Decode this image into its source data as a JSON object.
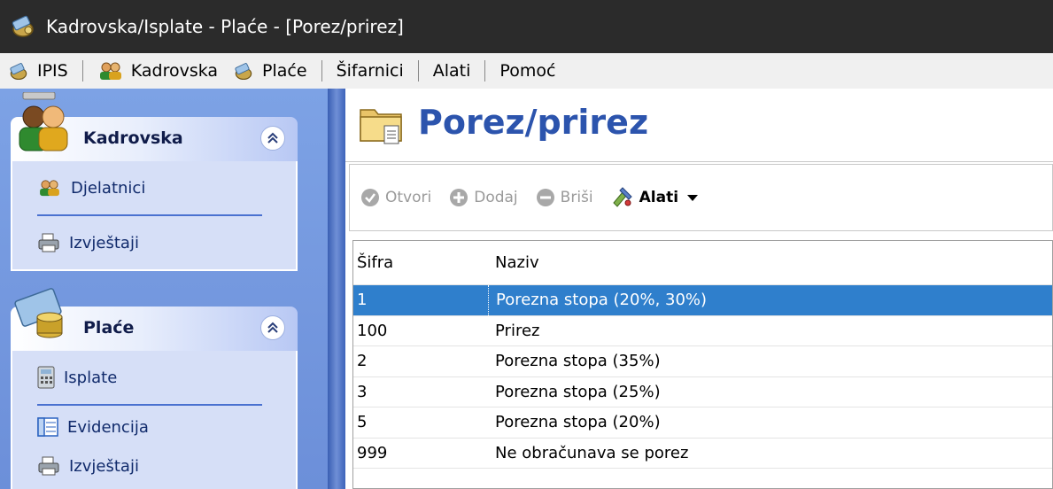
{
  "window": {
    "title": "Kadrovska/Isplate - Plaće - [Porez/prirez]",
    "app_icon": "money-bag-icon"
  },
  "menu": {
    "items": [
      {
        "label": "IPIS",
        "icon": "money-bag-icon"
      },
      {
        "label": "Kadrovska",
        "icon": "users-icon"
      },
      {
        "label": "Plaće",
        "icon": "money-bag-icon"
      },
      {
        "label": "Šifarnici",
        "icon": ""
      },
      {
        "label": "Alati",
        "icon": ""
      },
      {
        "label": "Pomoć",
        "icon": ""
      }
    ]
  },
  "sidebar": {
    "groups": [
      {
        "title": "Kadrovska",
        "icon": "people-group-icon",
        "items": [
          {
            "label": "Djelatnici",
            "icon": "users-icon"
          },
          {
            "label": "Izvještaji",
            "icon": "printer-icon"
          }
        ]
      },
      {
        "title": "Plaće",
        "icon": "coins-icon",
        "items": [
          {
            "label": "Isplate",
            "icon": "calculator-icon"
          },
          {
            "label": "Evidencija",
            "icon": "table-icon"
          },
          {
            "label": "Izvještaji",
            "icon": "printer-icon"
          }
        ]
      }
    ]
  },
  "page": {
    "title": "Porez/prirez",
    "icon": "folder-document-icon"
  },
  "toolbar": {
    "open_label": "Otvori",
    "add_label": "Dodaj",
    "delete_label": "Briši",
    "tools_label": "Alati"
  },
  "grid": {
    "columns": [
      "Šifra",
      "Naziv"
    ],
    "rows": [
      {
        "code": "1",
        "name": "Porezna stopa (20%, 30%)",
        "selected": true
      },
      {
        "code": "100",
        "name": "Prirez",
        "selected": false
      },
      {
        "code": "2",
        "name": "Porezna stopa (35%)",
        "selected": false
      },
      {
        "code": "3",
        "name": "Porezna stopa (25%)",
        "selected": false
      },
      {
        "code": "5",
        "name": "Porezna stopa (20%)",
        "selected": false
      },
      {
        "code": "999",
        "name": "Ne obračunava se porez",
        "selected": false
      }
    ]
  },
  "colors": {
    "title_bar": "#2b2b2b",
    "sidebar": "#7da2e5",
    "selection": "#2f7fcc",
    "page_title": "#2c54ad"
  }
}
